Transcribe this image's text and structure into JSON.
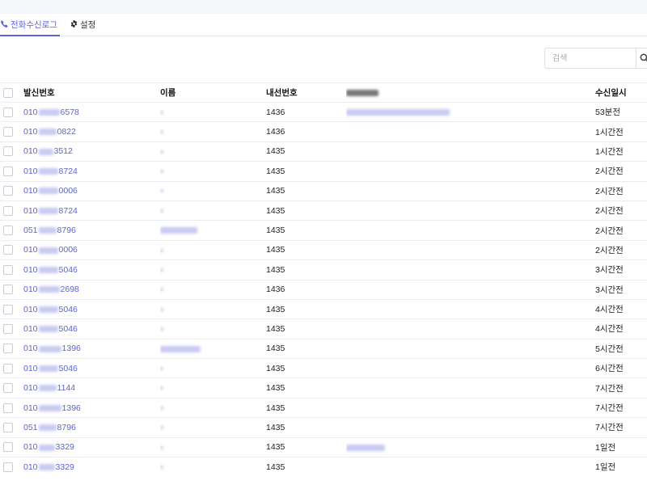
{
  "tabs": [
    {
      "label": "전화수신로그",
      "icon": "phone-icon",
      "active": true
    },
    {
      "label": "설정",
      "icon": "gear-icon",
      "active": false
    }
  ],
  "search": {
    "placeholder": "검색"
  },
  "table": {
    "columns": [
      "발신번호",
      "이름",
      "내선번호",
      "",
      "수신일시"
    ],
    "rows": [
      {
        "prefix": "010",
        "suffix": "6578",
        "ext": "1436",
        "time": "53분전"
      },
      {
        "prefix": "010",
        "suffix": "0822",
        "ext": "1436",
        "time": "1시간전"
      },
      {
        "prefix": "010",
        "suffix": "3512",
        "ext": "1435",
        "time": "1시간전"
      },
      {
        "prefix": "010",
        "suffix": "8724",
        "ext": "1435",
        "time": "2시간전"
      },
      {
        "prefix": "010",
        "suffix": "0006",
        "ext": "1435",
        "time": "2시간전"
      },
      {
        "prefix": "010",
        "suffix": "8724",
        "ext": "1435",
        "time": "2시간전"
      },
      {
        "prefix": "051",
        "suffix": "8796",
        "ext": "1435",
        "time": "2시간전"
      },
      {
        "prefix": "010",
        "suffix": "0006",
        "ext": "1435",
        "time": "2시간전"
      },
      {
        "prefix": "010",
        "suffix": "5046",
        "ext": "1435",
        "time": "3시간전"
      },
      {
        "prefix": "010",
        "suffix": "2698",
        "ext": "1436",
        "time": "3시간전"
      },
      {
        "prefix": "010",
        "suffix": "5046",
        "ext": "1435",
        "time": "4시간전"
      },
      {
        "prefix": "010",
        "suffix": "5046",
        "ext": "1435",
        "time": "4시간전"
      },
      {
        "prefix": "010",
        "suffix": "1396",
        "ext": "1435",
        "time": "5시간전"
      },
      {
        "prefix": "010",
        "suffix": "5046",
        "ext": "1435",
        "time": "6시간전"
      },
      {
        "prefix": "010",
        "suffix": "1144",
        "ext": "1435",
        "time": "7시간전"
      },
      {
        "prefix": "010",
        "suffix": "1396",
        "ext": "1435",
        "time": "7시간전"
      },
      {
        "prefix": "051",
        "suffix": "8796",
        "ext": "1435",
        "time": "7시간전"
      },
      {
        "prefix": "010",
        "suffix": "3329",
        "ext": "1435",
        "time": "1일전"
      },
      {
        "prefix": "010",
        "suffix": "3329",
        "ext": "1435",
        "time": "1일전"
      }
    ]
  },
  "colors": {
    "accent": "#5a63d8",
    "border": "#e9ebf0",
    "topbar": "#f5f6f9"
  }
}
